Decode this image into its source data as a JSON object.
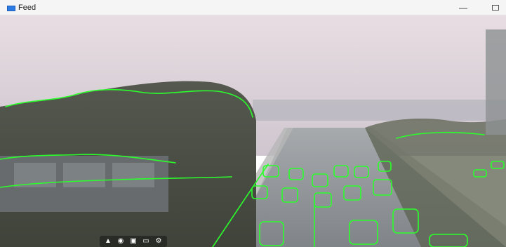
{
  "window": {
    "title": "Feed",
    "minimize_symbol": "—",
    "app_icon": "app-icon"
  },
  "feed": {
    "description_colors": {
      "sky_top": "#e9e2e6",
      "sky_bottom": "#c9c3cf",
      "road": "#9aa0a4",
      "foliage": "#4a4f44",
      "contour": "#2bff2b"
    }
  },
  "toolbar": {
    "icons": [
      "pointer-icon",
      "camera-icon",
      "video-icon",
      "screen-icon",
      "settings-icon"
    ]
  }
}
